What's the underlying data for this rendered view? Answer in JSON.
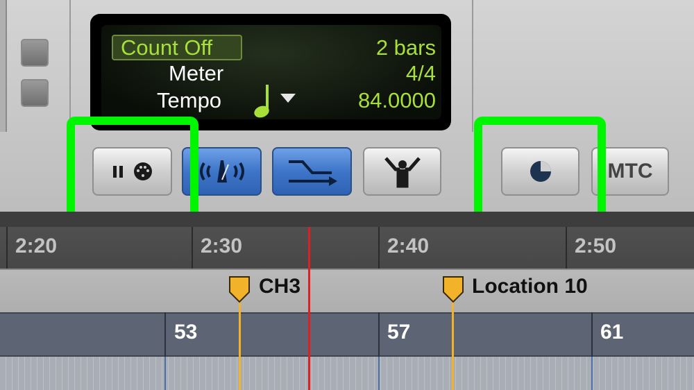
{
  "lcd": {
    "count_off_label": "Count Off",
    "count_off_value": "2 bars",
    "meter_label": "Meter",
    "meter_value": "4/4",
    "tempo_label": "Tempo",
    "tempo_value": "84.0000",
    "tempo_note_icon": "quarter-note-icon",
    "tempo_menu_icon": "triangle-down-icon"
  },
  "buttons": [
    {
      "name": "wait-for-note-button",
      "icon": "pause-midi-icon",
      "highlighted": true
    },
    {
      "name": "metronome-button",
      "icon": "metronome-click-icon",
      "active": true
    },
    {
      "name": "countoff-button",
      "icon": "arrow-right-icon",
      "active": true
    },
    {
      "name": "conductor-button",
      "icon": "conductor-icon"
    },
    {
      "name": "tempo-pie-button",
      "icon": "pie-chart-icon",
      "highlighted": true
    },
    {
      "name": "mtc-button",
      "label": "MTC"
    }
  ],
  "timeline": {
    "min_sec_labels": [
      "2:20",
      "2:30",
      "2:40",
      "2:50"
    ],
    "markers": [
      {
        "label": "CH3",
        "color": "#f2b22a"
      },
      {
        "label": "Location 10",
        "color": "#f2b22a"
      }
    ],
    "bar_labels": [
      "53",
      "57",
      "61"
    ]
  },
  "colors": {
    "lcd_green": "#a8e03a",
    "highlight": "#00f500",
    "playhead": "#e02020",
    "marker": "#f2b22a",
    "active_blue": "#3e75c8"
  }
}
